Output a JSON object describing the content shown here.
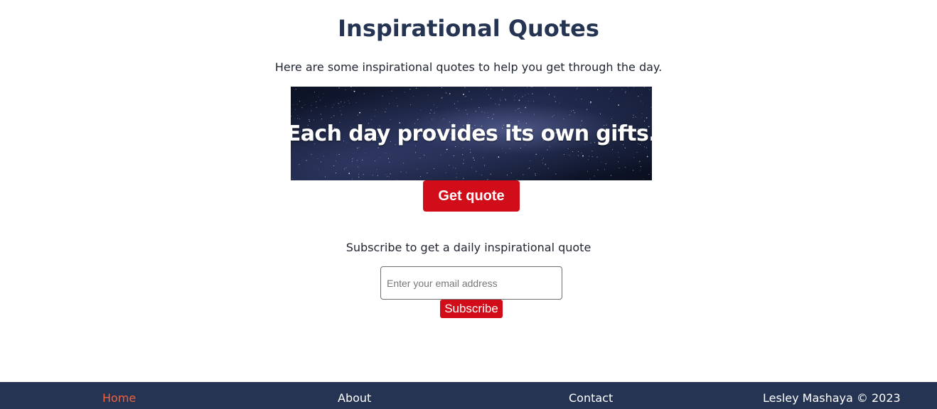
{
  "header": {
    "title": "Inspirational Quotes",
    "intro": "Here are some inspirational quotes to help you get through the day."
  },
  "quote": {
    "text": "Each day provides its own gifts.",
    "button_label": "Get quote"
  },
  "subscribe": {
    "prompt": "Subscribe to get a daily inspirational quote",
    "email_placeholder": "Enter your email address",
    "button_label": "Subscribe"
  },
  "footer": {
    "links": [
      {
        "label": "Home",
        "active": true
      },
      {
        "label": "About",
        "active": false
      },
      {
        "label": "Contact",
        "active": false
      }
    ],
    "copyright": "Lesley Mashaya © 2023"
  },
  "colors": {
    "heading": "#253452",
    "accent": "#d20d1a",
    "footer_bg": "#253452",
    "active_link": "#f5603a"
  }
}
